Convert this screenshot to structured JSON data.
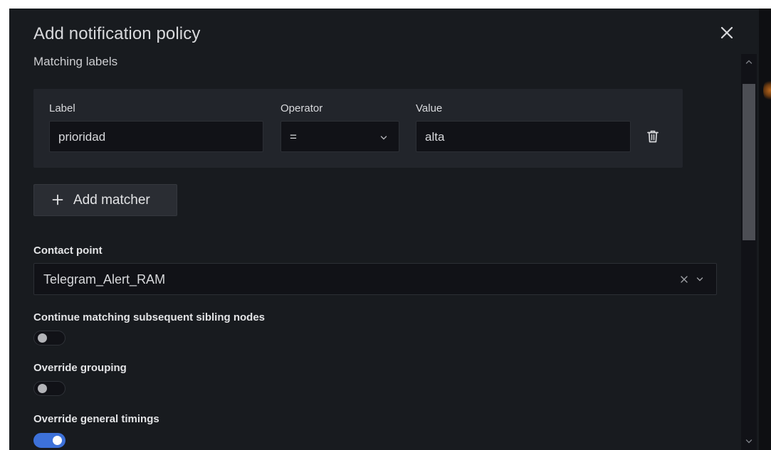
{
  "modal": {
    "title": "Add notification policy"
  },
  "matching_labels": {
    "title": "Matching labels",
    "label_header": "Label",
    "operator_header": "Operator",
    "value_header": "Value",
    "matcher": {
      "label": "prioridad",
      "operator": "=",
      "value": "alta"
    },
    "add_matcher_label": "Add matcher"
  },
  "contact_point": {
    "label": "Contact point",
    "value": "Telegram_Alert_RAM"
  },
  "toggles": [
    {
      "label": "Continue matching subsequent sibling nodes",
      "on": false
    },
    {
      "label": "Override grouping",
      "on": false
    },
    {
      "label": "Override general timings",
      "on": true
    }
  ],
  "icons": {
    "close": "close-icon",
    "delete": "trash-icon",
    "add": "plus-icon",
    "dropdown": "chevron-down-icon",
    "clear": "clear-icon"
  },
  "colors": {
    "modal_bg": "#181b1f",
    "input_bg": "#111217",
    "panel_bg": "#22252b",
    "toggle_on": "#3d71d9"
  }
}
